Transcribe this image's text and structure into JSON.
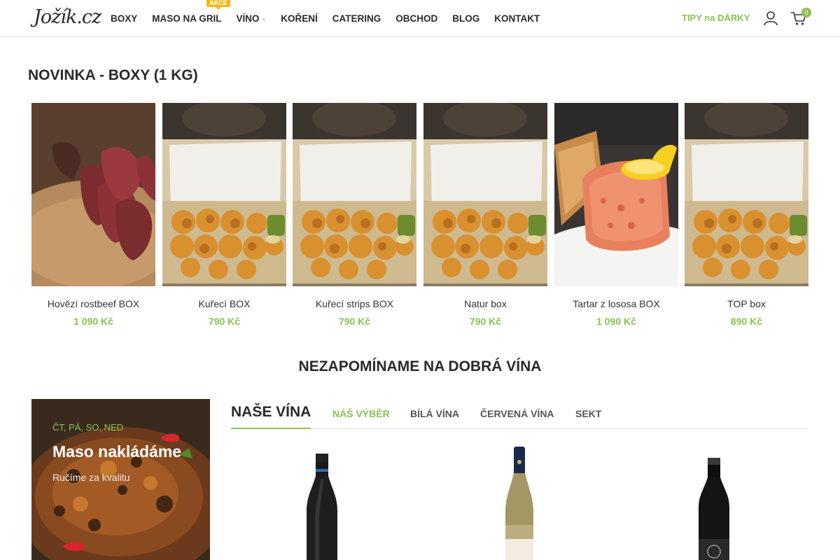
{
  "header": {
    "logo": "Jožík.cz",
    "nav": [
      {
        "label": "BOXY"
      },
      {
        "label": "MASO NA GRIL",
        "badge": "AKCE"
      },
      {
        "label": "VÍNO",
        "has_dropdown": true
      },
      {
        "label": "KOŘENÍ"
      },
      {
        "label": "CATERING"
      },
      {
        "label": "OBCHOD"
      },
      {
        "label": "BLOG"
      },
      {
        "label": "KONTAKT"
      }
    ],
    "tips_link": "TIPY na DÁRKY",
    "cart_count": "0",
    "accent_color": "#8cc152"
  },
  "boxes_section": {
    "title": "NOVINKA - BOXY (1 KG)",
    "products": [
      {
        "name": "Hovězí rostbeef BOX",
        "price": "1 090 Kč",
        "image": "sliced-beef"
      },
      {
        "name": "Kuřecí BOX",
        "price": "790 Kč",
        "image": "fried-chicken-box"
      },
      {
        "name": "Kuřecí strips BOX",
        "price": "790 Kč",
        "image": "fried-chicken-box"
      },
      {
        "name": "Natur box",
        "price": "790 Kč",
        "image": "fried-chicken-box"
      },
      {
        "name": "Tartar z lososa BOX",
        "price": "1 090 Kč",
        "image": "salmon-tartare"
      },
      {
        "name": "TOP box",
        "price": "890 Kč",
        "image": "fried-chicken-box"
      }
    ]
  },
  "wine_section": {
    "heading": "NEZAPOMÍNAME NA DOBRÁ VÍNA",
    "promo": {
      "days": "ČT, PÁ, SO, NED",
      "title": "Maso nakládáme",
      "subtitle": "Ručíme za kvalitu"
    },
    "tabs_title": "NAŠE VÍNA",
    "tabs": [
      {
        "label": "NÁŠ VÝBĚR",
        "active": true
      },
      {
        "label": "BÍLÁ VÍNA",
        "active": false
      },
      {
        "label": "ČERVENÁ VÍNA",
        "active": false
      },
      {
        "label": "SEKT",
        "active": false
      }
    ]
  }
}
